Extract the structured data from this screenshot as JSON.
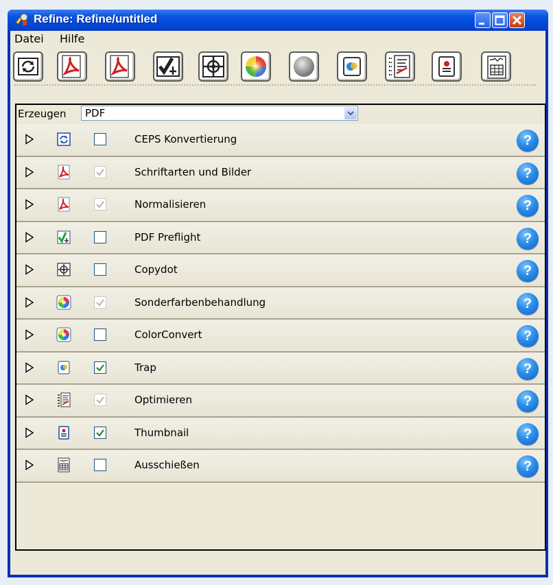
{
  "window": {
    "title": "Refine: Refine/untitled"
  },
  "menu": {
    "items": [
      "Datei",
      "Hilfe"
    ]
  },
  "toolbar": {
    "tools": [
      "refresh-icon",
      "pdf-fonts-icon",
      "pdf-normalize-icon",
      "preflight-icon",
      "copydot-icon",
      "color-wheel-icon",
      "gray-sphere-icon",
      "trap-icon",
      "optimize-icon",
      "thumbnail-icon",
      "impose-icon"
    ]
  },
  "produce": {
    "label": "Erzeugen",
    "value": "PDF"
  },
  "rows": [
    {
      "label": "CEPS Konvertierung",
      "icon": "refresh-icon",
      "checked": false,
      "enabled": true
    },
    {
      "label": "Schriftarten und Bilder",
      "icon": "pdf-icon",
      "checked": true,
      "enabled": false
    },
    {
      "label": "Normalisieren",
      "icon": "pdf-icon",
      "checked": true,
      "enabled": false
    },
    {
      "label": "PDF Preflight",
      "icon": "preflight-icon",
      "checked": false,
      "enabled": true
    },
    {
      "label": "Copydot",
      "icon": "copydot-icon",
      "checked": false,
      "enabled": true
    },
    {
      "label": "Sonderfarbenbehandlung",
      "icon": "color-wheel-icon",
      "checked": true,
      "enabled": false
    },
    {
      "label": "ColorConvert",
      "icon": "color-wheel-icon",
      "checked": false,
      "enabled": true
    },
    {
      "label": "Trap",
      "icon": "trap-icon",
      "checked": true,
      "enabled": true
    },
    {
      "label": "Optimieren",
      "icon": "optimize-icon",
      "checked": true,
      "enabled": false
    },
    {
      "label": "Thumbnail",
      "icon": "thumbnail-icon",
      "checked": true,
      "enabled": true
    },
    {
      "label": "Ausschießen",
      "icon": "impose-icon",
      "checked": false,
      "enabled": true
    }
  ],
  "help": {
    "symbol": "?"
  },
  "colors": {
    "titlebar": "#0a56e0",
    "face": "#ece9d8",
    "help": "#2b8de8",
    "check": "#1e8a1e"
  }
}
